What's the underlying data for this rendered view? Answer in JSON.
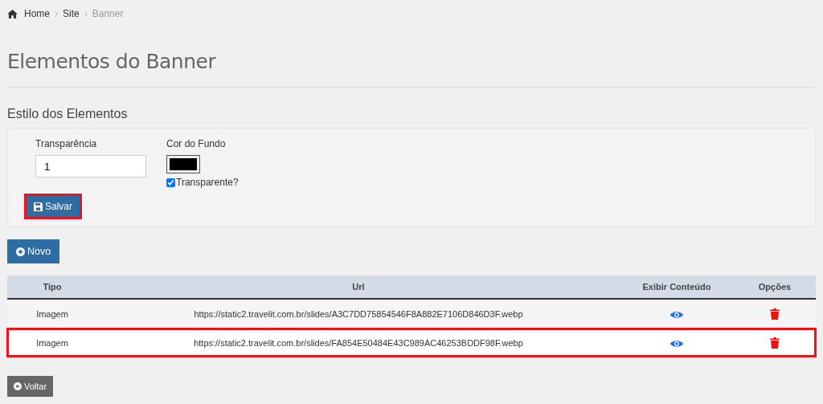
{
  "breadcrumb": [
    {
      "label": "Home"
    },
    {
      "label": "Site"
    },
    {
      "label": "Banner"
    }
  ],
  "page_title": "Elementos do Banner",
  "section_title": "Estilo dos Elementos",
  "form": {
    "transparency_label": "Transparência",
    "transparency_value": "1",
    "color_label": "Cor do Fundo",
    "color": "#000000",
    "transparent_label": "Transparente?",
    "transparent_checked": true,
    "save_button": {
      "label": "Salvar",
      "highlighted": true
    }
  },
  "new_button": "Novo",
  "table": {
    "columns": [
      "Tipo",
      "Url",
      "Exibir Conteúdo",
      "Opções"
    ],
    "rows": [
      {
        "tipo": "Imagem",
        "url": "https://static2.travelit.com.br/slides/A3C7DD75854546F8A882E7106D846D3F.webp",
        "highlighted": false
      },
      {
        "tipo": "Imagem",
        "url": "https://static2.travelit.com.br/slides/FA854E50484E43C989AC46253BDDF98F.webp",
        "highlighted": true
      }
    ]
  },
  "back_button": "Voltar"
}
